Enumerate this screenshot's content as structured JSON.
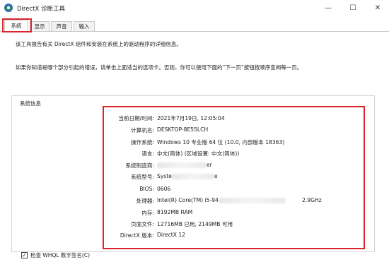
{
  "window": {
    "title": "DirectX 诊断工具",
    "minimize_glyph": "—",
    "maximize_glyph": "☐",
    "close_glyph": "✕"
  },
  "tabs": [
    {
      "label": "系统",
      "active": true
    },
    {
      "label": "显示",
      "active": false
    },
    {
      "label": "声音",
      "active": false
    },
    {
      "label": "输入",
      "active": false
    }
  ],
  "intro": {
    "line1": "该工具报告有关 DirectX 组件和安装在系统上的驱动程序的详细信息。",
    "line2": "如果你知道是哪个部分引起的错误，请单击上面适当的选项卡。否则，你可以使用下面的“下一页”按钮按顺序查阅每一页。"
  },
  "system_info": {
    "group_title": "系统信息",
    "rows": [
      {
        "label": "当前日期/时间:",
        "value": "2021年7月19日, 12:05:04"
      },
      {
        "label": "计算机名:",
        "value": "DESKTOP-8E55LCH"
      },
      {
        "label": "操作系统:",
        "value": "Windows 10 专业版 64 位 (10.0, 内部版本 18363)"
      },
      {
        "label": "语言:",
        "value": "中文(简体) (区域设置: 中文(简体))"
      },
      {
        "label": "系统制造商:",
        "value": "",
        "value_tail": "er"
      },
      {
        "label": "系统型号:",
        "value": "Syste",
        "value_tail": "e"
      },
      {
        "label": "BIOS:",
        "value": "0606"
      },
      {
        "label": "处理器:",
        "value": "Intel(R) Core(TM) i5-94",
        "extra": "2.9GHz"
      },
      {
        "label": "内存:",
        "value": "8192MB RAM"
      },
      {
        "label": "页面文件:",
        "value": "12716MB 已用, 2149MB 可用"
      },
      {
        "label": "DirectX 版本:",
        "value": "DirectX 12"
      }
    ]
  },
  "whql": {
    "checked": true,
    "check_glyph": "✓",
    "label": "检查 WHQL 数字签名(C)"
  },
  "colors": {
    "highlight_red": "#d9262d",
    "icon_blue": "#2a6fb5",
    "icon_green": "#3e9a3a"
  },
  "icons": {
    "app": "directx-app-icon"
  }
}
